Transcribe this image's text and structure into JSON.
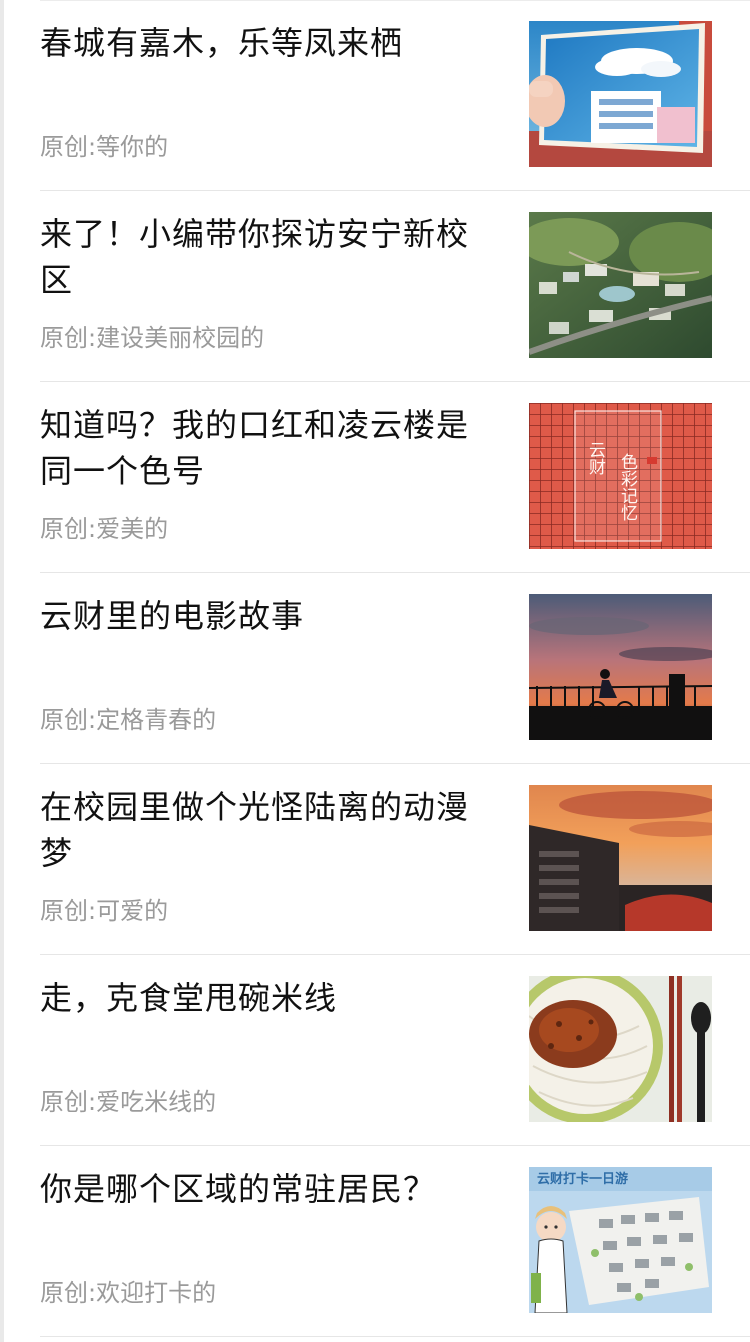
{
  "articles": [
    {
      "title": "春城有嘉木，乐等凤来栖",
      "meta": "原创:等你的",
      "thumb": "postcard-building-thumbnail"
    },
    {
      "title": "来了！小编带你探访安宁新校区",
      "meta": "原创:建设美丽校园的",
      "thumb": "campus-aerial-thumbnail"
    },
    {
      "title": "知道吗？我的口红和凌云楼是同一个色号",
      "meta": "原创:爱美的",
      "thumb": "red-grid-poster-thumbnail",
      "thumb_text": {
        "col1": "云财",
        "col2": "色彩记忆"
      }
    },
    {
      "title": "云财里的电影故事",
      "meta": "原创:定格青春的",
      "thumb": "sunset-cyclist-thumbnail"
    },
    {
      "title": "在校园里做个光怪陆离的动漫梦",
      "meta": "原创:可爱的",
      "thumb": "sunset-building-thumbnail"
    },
    {
      "title": "走，克食堂甩碗米线",
      "meta": "原创:爱吃米线的",
      "thumb": "rice-noodles-thumbnail"
    },
    {
      "title": "你是哪个区域的常驻居民？",
      "meta": "原创:欢迎打卡的",
      "thumb": "campus-map-thumbnail",
      "thumb_text": {
        "banner": "云财打卡一日游"
      }
    }
  ]
}
